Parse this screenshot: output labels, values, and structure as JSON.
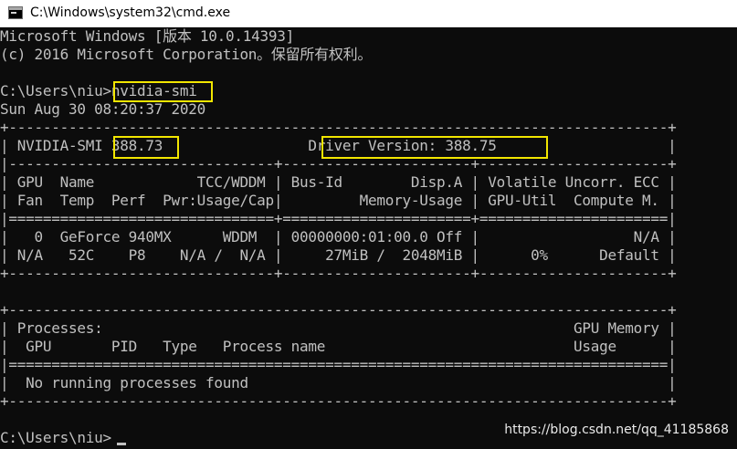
{
  "window": {
    "title": "C:\\Windows\\system32\\cmd.exe"
  },
  "console": {
    "lines": [
      "Microsoft Windows [版本 10.0.14393]",
      "(c) 2016 Microsoft Corporation。保留所有权利。",
      "",
      "C:\\Users\\niu>nvidia-smi",
      "Sun Aug 30 08:20:37 2020",
      "+-----------------------------------------------------------------------------+",
      "| NVIDIA-SMI 388.73                 Driver Version: 388.75                    |",
      "|-------------------------------+----------------------+----------------------+",
      "| GPU  Name            TCC/WDDM | Bus-Id        Disp.A | Volatile Uncorr. ECC |",
      "| Fan  Temp  Perf  Pwr:Usage/Cap|         Memory-Usage | GPU-Util  Compute M. |",
      "|===============================+======================+======================|",
      "|   0  GeForce 940MX      WDDM  | 00000000:01:00.0 Off |                  N/A |",
      "| N/A   52C    P8    N/A /  N/A |     27MiB /  2048MiB |      0%      Default |",
      "+-------------------------------+----------------------+----------------------+",
      "",
      "+-----------------------------------------------------------------------------+",
      "| Processes:                                                       GPU Memory |",
      "|  GPU       PID   Type   Process name                             Usage      |",
      "|=============================================================================|",
      "|  No running processes found                                                 |",
      "+-----------------------------------------------------------------------------+",
      "",
      "C:\\Users\\niu>"
    ],
    "command": "nvidia-smi",
    "smi_version": "388.73",
    "driver_version_text": "Driver Version: 388.75"
  },
  "watermark": "https://blog.csdn.net/qq_41185868",
  "colors": {
    "console_bg": "#0c0c0c",
    "console_text": "#c0c0c0",
    "highlight": "#f2e600"
  }
}
